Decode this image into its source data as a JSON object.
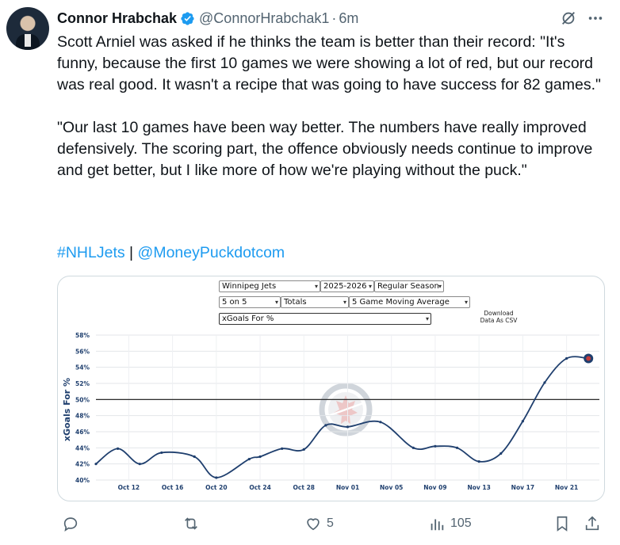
{
  "tweet": {
    "author_name": "Connor Hrabchak",
    "handle": "@ConnorHrabchak1",
    "separator": "·",
    "time": "6m",
    "paragraph_1": "Scott Arniel was asked if he thinks the team is better than their record: \"It's funny, because the first 10 games we were showing a lot of red, but our record was real good. It wasn't a recipe that was going to have success for 82 games.\"",
    "paragraph_2": "\"Our last 10 games have been way better. The numbers have really improved defensively. The scoring part, the offence obviously needs continue to improve and get better, but I like more of how we're playing without the puck.\"",
    "hashtag": "#NHLJets",
    "divider": "|",
    "mention": "@MoneyPuckdotcom"
  },
  "controls": {
    "team": "Winnipeg Jets",
    "season": "2025-2026",
    "season_type": "Regular Season",
    "situation": "5 on 5",
    "stat_type": "Totals",
    "smoothing": "5 Game Moving Average",
    "metric": "xGoals For %",
    "download_line1": "Download",
    "download_line2": "Data As CSV"
  },
  "chart_data": {
    "type": "line",
    "ylabel": "xGoals For %",
    "xlabel": "",
    "ylim": [
      40,
      58
    ],
    "y_ticks": [
      "40%",
      "42%",
      "44%",
      "46%",
      "48%",
      "50%",
      "52%",
      "54%",
      "56%",
      "58%"
    ],
    "x_ticks": [
      "Oct 12",
      "Oct 16",
      "Oct 20",
      "Oct 24",
      "Oct 28",
      "Nov 01",
      "Nov 05",
      "Nov 09",
      "Nov 13",
      "Nov 17",
      "Nov 21"
    ],
    "reference_line": 50,
    "grid": true,
    "series": [
      {
        "color": "#1f3f6e",
        "x": [
          "Oct 09",
          "Oct 11",
          "Oct 13",
          "Oct 15",
          "Oct 18",
          "Oct 20",
          "Oct 23",
          "Oct 24",
          "Oct 26",
          "Oct 28",
          "Oct 30",
          "Nov 01",
          "Nov 04",
          "Nov 07",
          "Nov 09",
          "Nov 11",
          "Nov 13",
          "Nov 15",
          "Nov 17",
          "Nov 19",
          "Nov 21",
          "Nov 23"
        ],
        "values": [
          42.0,
          43.9,
          42.0,
          43.4,
          42.9,
          40.3,
          42.6,
          42.9,
          43.9,
          43.8,
          46.8,
          46.6,
          47.2,
          44.0,
          44.2,
          44.0,
          42.3,
          43.3,
          47.3,
          52.1,
          55.1,
          55.1
        ]
      }
    ]
  },
  "stats": {
    "replies": "",
    "reposts": "",
    "likes": "5",
    "views": "105"
  },
  "colors": {
    "link": "#1d9bf0",
    "verified": "#1d9bf0",
    "muted": "#536471",
    "line": "#1f3f6e"
  }
}
